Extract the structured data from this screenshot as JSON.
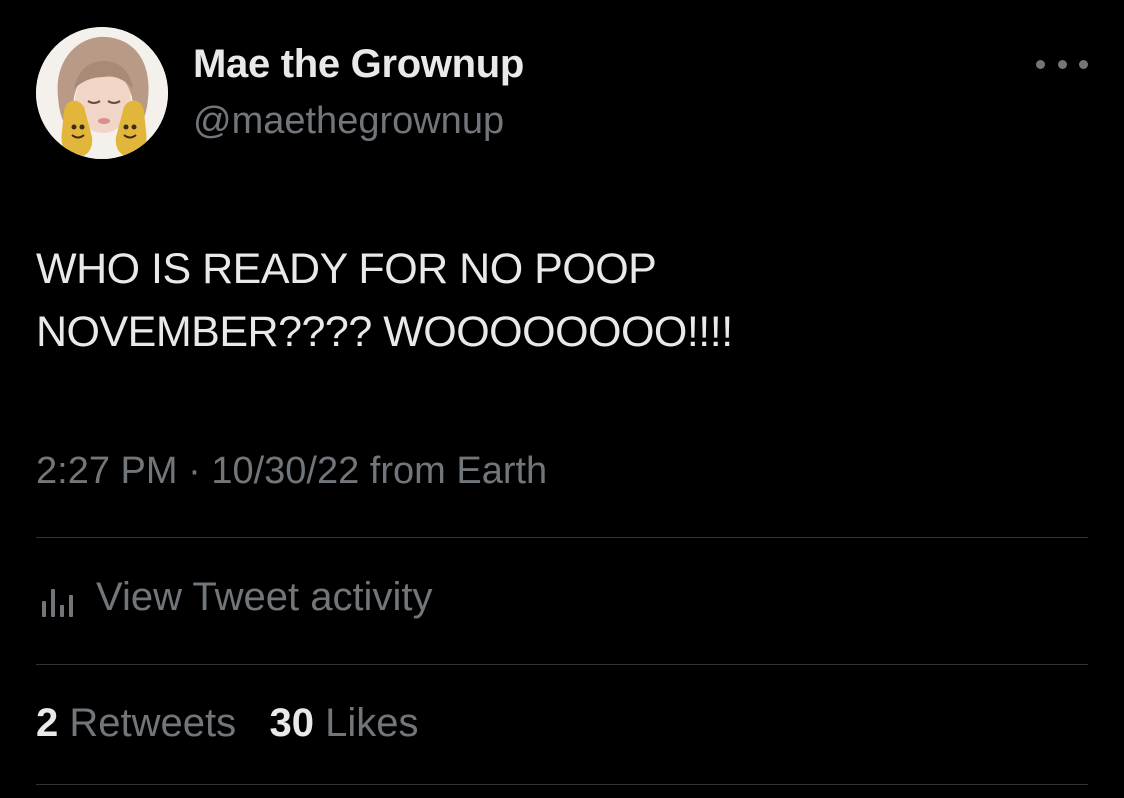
{
  "user": {
    "display_name": "Mae the Grownup",
    "handle": "@maethegrownup",
    "avatar_icon": "avatar-photo-icon"
  },
  "tweet": {
    "text_lines": [
      "WHO IS READY FOR NO POOP",
      "NOVEMBER???? WOOOOOOOO!!!!"
    ],
    "time": "2:27 PM",
    "separator": "·",
    "date": "10/30/22",
    "source": "from Earth"
  },
  "activity": {
    "label": "View Tweet activity",
    "icon": "analytics-icon"
  },
  "stats": {
    "retweets_count": "2",
    "retweets_label": "Retweets",
    "likes_count": "30",
    "likes_label": "Likes"
  },
  "menu": {
    "icon": "more-options-icon"
  },
  "colors": {
    "background": "#000000",
    "primary_text": "#e7e9ea",
    "secondary_text": "#71767b",
    "divider": "#2f3336"
  }
}
